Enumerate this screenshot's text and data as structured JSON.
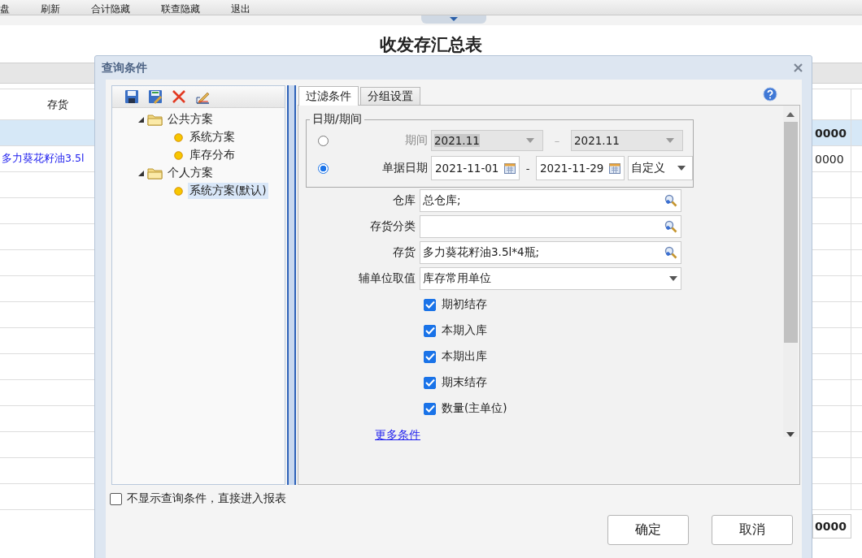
{
  "toolbar": [
    "盘",
    "刷新",
    "合计隐藏",
    "联查隐藏",
    "退出"
  ],
  "report": {
    "title": "收发存汇总表",
    "column": "存货",
    "rows": [
      {
        "selected": true,
        "amount": "0000"
      },
      {
        "selected": false,
        "item": "多力葵花籽油3.5l",
        "amount": "0000"
      }
    ],
    "total": "0000"
  },
  "dialog": {
    "title": "查询条件",
    "schemes": [
      {
        "label": "公共方案",
        "expanded": true,
        "children": [
          {
            "label": "系统方案",
            "selected": false
          },
          {
            "label": "库存分布",
            "selected": false
          }
        ]
      },
      {
        "label": "个人方案",
        "expanded": true,
        "children": [
          {
            "label": "系统方案(默认)",
            "selected": true
          }
        ]
      }
    ],
    "tabs": [
      {
        "label": "过滤条件",
        "selected": true
      },
      {
        "label": "分组设置",
        "selected": false
      }
    ],
    "date_group": {
      "title": "日期/期间",
      "options": [
        {
          "kind": "period",
          "label": "期间",
          "selected": false,
          "disabled": true,
          "from": "2021.11",
          "separator": "–",
          "to": "2021.11"
        },
        {
          "kind": "date",
          "label": "单据日期",
          "selected": true,
          "disabled": false,
          "from": "2021-11-01",
          "separator": "-",
          "to": "2021-11-29",
          "range": "自定义"
        }
      ]
    },
    "fields": [
      {
        "kind": "lookup",
        "label": "仓库",
        "value": "总仓库;"
      },
      {
        "kind": "lookup",
        "label": "存货分类"
      },
      {
        "kind": "lookup",
        "label": "存货",
        "value": "多力葵花籽油3.5l*4瓶;"
      },
      {
        "kind": "select",
        "label": "辅单位取值",
        "value": "库存常用单位"
      }
    ],
    "checks": [
      {
        "label": "期初结存",
        "checked": true
      },
      {
        "label": "本期入库",
        "checked": true
      },
      {
        "label": "本期出库",
        "checked": true
      },
      {
        "label": "期末结存",
        "checked": true
      },
      {
        "label": "数量(主单位)",
        "checked": true
      }
    ],
    "more_link": "更多条件",
    "skip_option": {
      "label": "不显示查询条件，直接进入报表",
      "checked": false
    },
    "buttons": [
      "确定",
      "取消"
    ]
  }
}
